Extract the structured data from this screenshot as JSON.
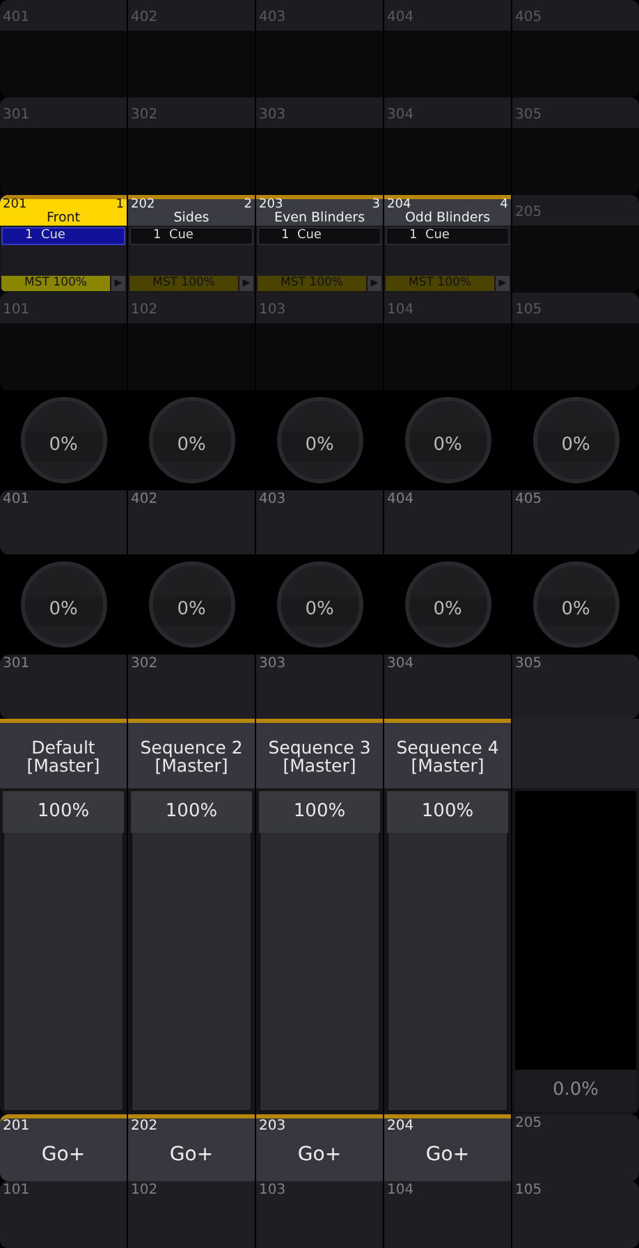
{
  "rows": [
    {
      "kind": "slot",
      "cells": [
        {
          "number": "401"
        },
        {
          "number": "402"
        },
        {
          "number": "403"
        },
        {
          "number": "404"
        },
        {
          "number": "405"
        }
      ]
    },
    {
      "kind": "slot",
      "cells": [
        {
          "number": "301"
        },
        {
          "number": "302"
        },
        {
          "number": "303"
        },
        {
          "number": "304"
        },
        {
          "number": "305"
        }
      ]
    },
    {
      "kind": "sequence",
      "cells": [
        {
          "number": "201",
          "page": "1",
          "name": "Front",
          "selected": true,
          "cue": "1  Cue",
          "master": "MST 100%",
          "play": "▶"
        },
        {
          "number": "202",
          "page": "2",
          "name": "Sides",
          "selected": false,
          "cue": "1  Cue",
          "master": "MST 100%",
          "play": "▶"
        },
        {
          "number": "203",
          "page": "3",
          "name": "Even Blinders",
          "selected": false,
          "cue": "1  Cue",
          "master": "MST 100%",
          "play": "▶"
        },
        {
          "number": "204",
          "page": "4",
          "name": "Odd Blinders",
          "selected": false,
          "cue": "1  Cue",
          "master": "MST 100%",
          "play": "▶"
        },
        {
          "number": "205"
        }
      ]
    },
    {
      "kind": "slot",
      "cells": [
        {
          "number": "101"
        },
        {
          "number": "102"
        },
        {
          "number": "103"
        },
        {
          "number": "104"
        },
        {
          "number": "105"
        }
      ]
    },
    {
      "kind": "knob",
      "cells": [
        {
          "reading": "0%"
        },
        {
          "reading": "0%"
        },
        {
          "reading": "0%"
        },
        {
          "reading": "0%"
        },
        {
          "reading": "0%"
        }
      ]
    },
    {
      "kind": "button",
      "cells": [
        {
          "number": "401",
          "assigned": false
        },
        {
          "number": "402",
          "assigned": false
        },
        {
          "number": "403",
          "assigned": false
        },
        {
          "number": "404",
          "assigned": false
        },
        {
          "number": "405",
          "assigned": false
        }
      ]
    },
    {
      "kind": "knob",
      "cells": [
        {
          "reading": "0%"
        },
        {
          "reading": "0%"
        },
        {
          "reading": "0%"
        },
        {
          "reading": "0%"
        },
        {
          "reading": "0%"
        }
      ]
    },
    {
      "kind": "button",
      "cells": [
        {
          "number": "301",
          "assigned": false
        },
        {
          "number": "302",
          "assigned": false
        },
        {
          "number": "303",
          "assigned": false
        },
        {
          "number": "304",
          "assigned": false
        },
        {
          "number": "305",
          "assigned": false
        }
      ]
    },
    {
      "kind": "fader",
      "cells": [
        {
          "title": "Default",
          "subtitle": "[Master]",
          "reading": "100%",
          "level": 1,
          "assigned": true
        },
        {
          "title": "Sequence 2",
          "subtitle": "[Master]",
          "reading": "100%",
          "level": 1,
          "assigned": true
        },
        {
          "title": "Sequence 3",
          "subtitle": "[Master]",
          "reading": "100%",
          "level": 1,
          "assigned": true
        },
        {
          "title": "Sequence 4",
          "subtitle": "[Master]",
          "reading": "100%",
          "level": 1,
          "assigned": true
        },
        {
          "reading": "0.0%",
          "level": 0,
          "assigned": false
        }
      ]
    },
    {
      "kind": "go",
      "cells": [
        {
          "number": "201",
          "label": "Go+",
          "assigned": true
        },
        {
          "number": "202",
          "label": "Go+",
          "assigned": true
        },
        {
          "number": "203",
          "label": "Go+",
          "assigned": true
        },
        {
          "number": "204",
          "label": "Go+",
          "assigned": true
        },
        {
          "number": "205",
          "assigned": false
        }
      ]
    },
    {
      "kind": "button",
      "cells": [
        {
          "number": "101",
          "assigned": false
        },
        {
          "number": "102",
          "assigned": false
        },
        {
          "number": "103",
          "assigned": false
        },
        {
          "number": "104",
          "assigned": false
        },
        {
          "number": "105",
          "assigned": false
        }
      ]
    }
  ]
}
